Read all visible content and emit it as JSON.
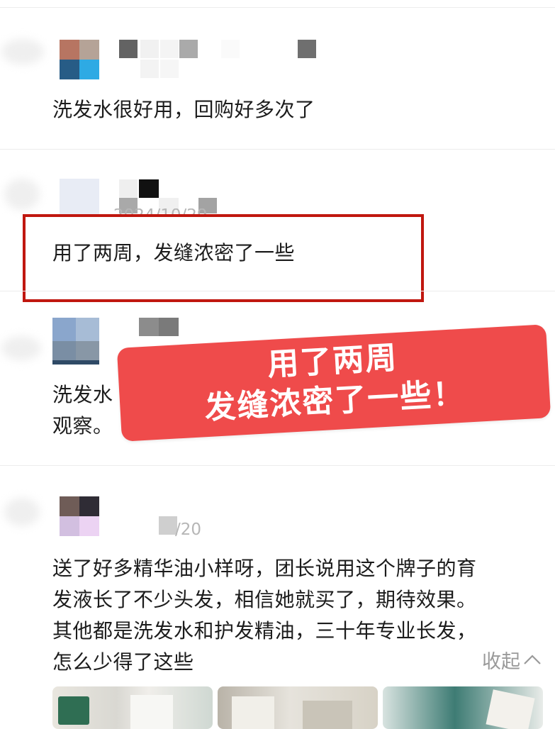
{
  "comments": [
    {
      "text": "洗发水很好用，回购好多次了"
    },
    {
      "date": "2024/10/29",
      "text": "用了两周，发缝浓密了一些"
    },
    {
      "text_line1": "洗发水",
      "text_line2": "观察。"
    },
    {
      "date": "/20",
      "lines": [
        "送了好多精华油小样呀，团长说用这个牌子的育",
        "发液长了不少头发，相信她就买了，期待效果。",
        "其他都是洗发水和护发精油，三十年专业长发，",
        "怎么少得了这些"
      ]
    }
  ],
  "callout": {
    "line1": "用了两周",
    "line2": "发缝浓密了一些！"
  },
  "collapse": {
    "label": "收起"
  },
  "colors": {
    "highlight_border": "#c0170f",
    "callout_bg": "#ef4b4b",
    "muted_text": "#9a9a9a"
  },
  "icons": [
    "chevron-up-icon"
  ]
}
